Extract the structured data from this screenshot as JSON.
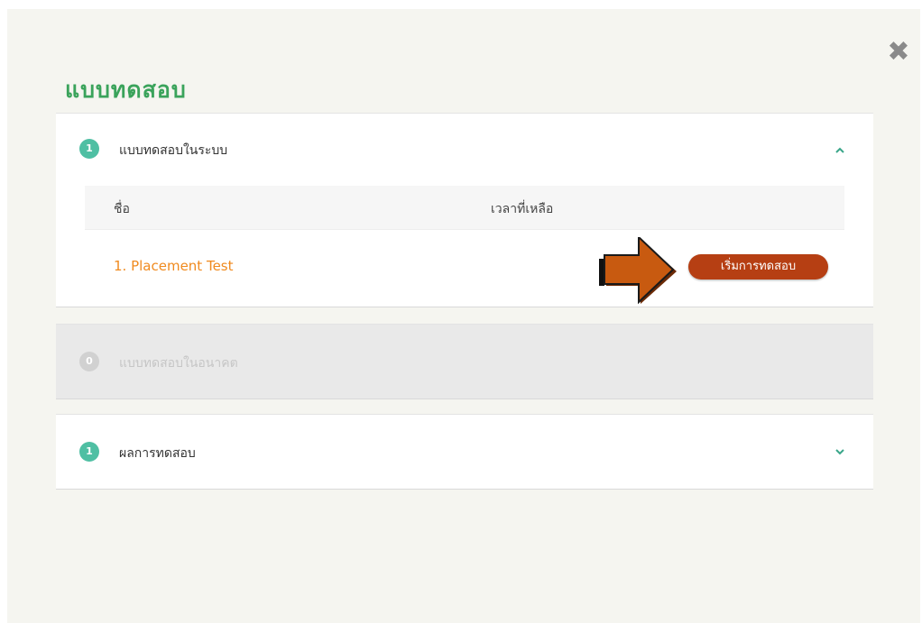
{
  "modal": {
    "title": "แบบทดสอบ",
    "close_icon": "close-icon"
  },
  "sections": [
    {
      "count": "1",
      "title": "แบบทดสอบในระบบ",
      "state": "expanded",
      "chevron": "^",
      "table": {
        "headers": [
          "ชื่อ",
          "เวลาที่เหลือ"
        ],
        "rows": [
          {
            "name": "1. Placement Test",
            "remaining": "",
            "action_label": "เริ่มการทดสอบ"
          }
        ]
      }
    },
    {
      "count": "0",
      "title": "แบบทดสอบในอนาคต",
      "state": "disabled"
    },
    {
      "count": "1",
      "title": "ผลการทดสอบ",
      "state": "collapsed",
      "chevron": "v"
    }
  ],
  "colors": {
    "accent_green": "#3aa35b",
    "badge_teal": "#4fbfa3",
    "link_orange": "#f08a1e",
    "button_red": "#b63f13",
    "arrow_orange": "#c85a10"
  }
}
